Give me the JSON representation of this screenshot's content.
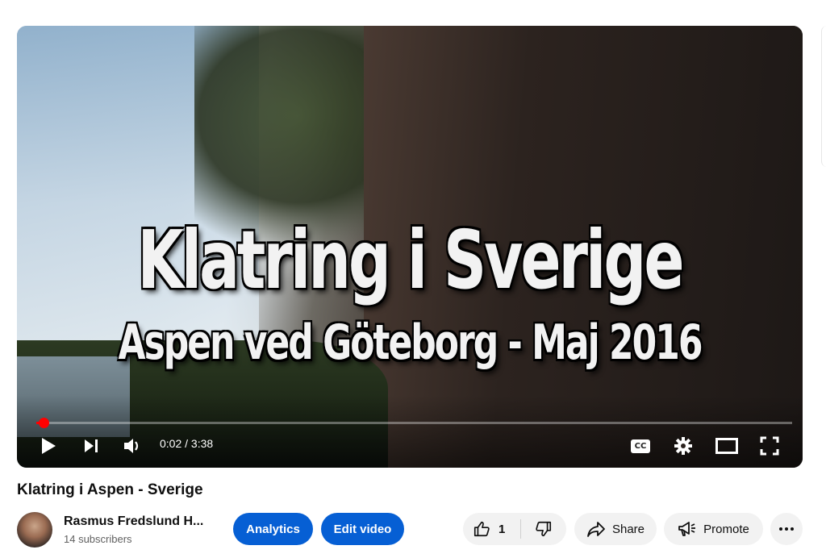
{
  "player": {
    "overlay_title": "Klatring i Sverige",
    "overlay_subtitle": "Aspen ved Göteborg - Maj 2016",
    "time_display": "0:02 / 3:38",
    "progress": 0.0092,
    "controls": {
      "play_icon": "play-icon",
      "next_icon": "next-icon",
      "volume_icon": "volume-icon",
      "cc_icon": "closed-captions-icon",
      "cc_text": "CC",
      "settings_icon": "gear-icon",
      "theater_icon": "theater-mode-icon",
      "fullscreen_icon": "fullscreen-icon"
    },
    "accent_color": "#ff0000"
  },
  "video": {
    "title": "Klatring i Aspen - Sverige"
  },
  "channel": {
    "name": "Rasmus Fredslund H...",
    "subscribers": "14 subscribers"
  },
  "actions": {
    "analytics_label": "Analytics",
    "edit_label": "Edit video",
    "like_count": "1",
    "share_label": "Share",
    "promote_label": "Promote",
    "primary_color": "#065fd4"
  }
}
